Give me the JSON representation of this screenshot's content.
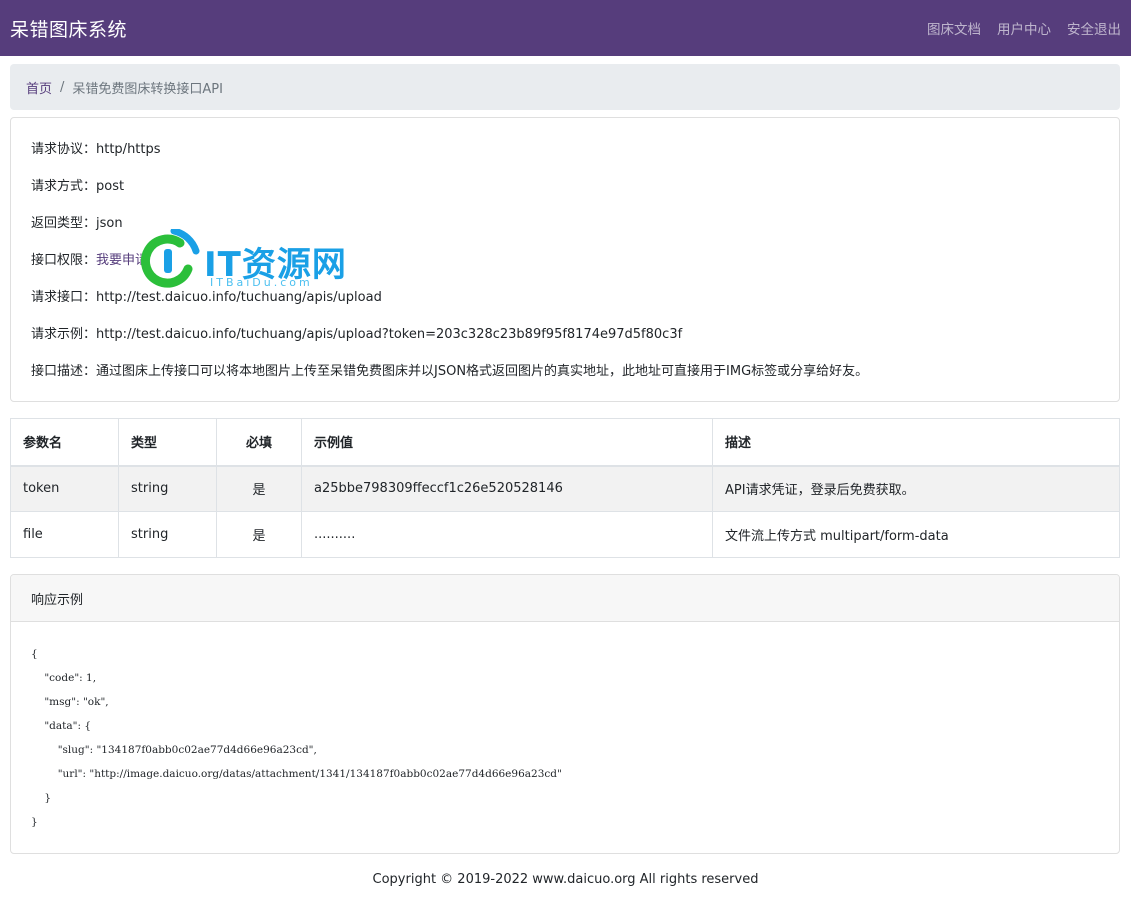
{
  "navbar": {
    "brand": "呆错图床系统",
    "links": [
      "图床文档",
      "用户中心",
      "安全退出"
    ]
  },
  "breadcrumb": {
    "home": "首页",
    "separator": "/",
    "current": "呆错免费图床转换接口API"
  },
  "info": {
    "protocol": "请求协议：http/https",
    "method": "请求方式：post",
    "return_type": "返回类型：json",
    "permission_label": "接口权限：",
    "permission_link": "我要申请",
    "endpoint": "请求接口：http://test.daicuo.info/tuchuang/apis/upload",
    "example": "请求示例：http://test.daicuo.info/tuchuang/apis/upload?token=203c328c23b89f95f8174e97d5f80c3f",
    "description": "接口描述：通过图床上传接口可以将本地图片上传至呆错免费图床并以JSON格式返回图片的真实地址，此地址可直接用于IMG标签或分享给好友。"
  },
  "watermark": {
    "text": "IT资源网",
    "subtext": "ITBaiDu.com"
  },
  "params": {
    "headers": [
      "参数名",
      "类型",
      "必填",
      "示例值",
      "描述"
    ],
    "rows": [
      {
        "name": "token",
        "type": "string",
        "required": "是",
        "example": "a25bbe798309ffeccf1c26e520528146",
        "desc": "API请求凭证，登录后免费获取。"
      },
      {
        "name": "file",
        "type": "string",
        "required": "是",
        "example": "..........",
        "desc": "文件流上传方式 multipart/form-data"
      }
    ]
  },
  "response": {
    "title": "响应示例",
    "lines": [
      "{",
      "    \"code\": 1,",
      "    \"msg\": \"ok\",",
      "    \"data\": {",
      "        \"slug\": \"134187f0abb0c02ae77d4d66e96a23cd\",",
      "        \"url\": \"http://image.daicuo.org/datas/attachment/1341/134187f0abb0c02ae77d4d66e96a23cd\"",
      "    }",
      "}"
    ]
  },
  "footer": {
    "copyright": "Copyright © 2019-2022 www.daicuo.org All rights reserved"
  },
  "colors": {
    "navbar_bg": "#563d7c",
    "link": "#563d7c",
    "watermark_blue": "#1aa0e6",
    "watermark_green": "#2bbf3a"
  }
}
